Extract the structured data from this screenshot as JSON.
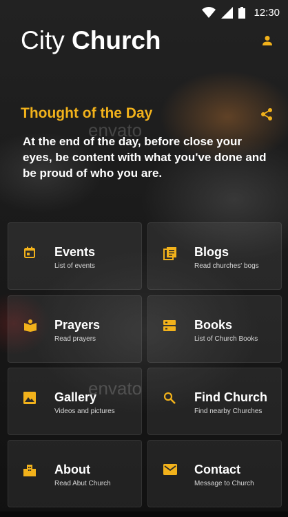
{
  "status_bar": {
    "time": "12:30"
  },
  "header": {
    "title_light": "City",
    "title_bold": "Church"
  },
  "thought": {
    "title": "Thought of the Day",
    "text": "At the end of the day, before close your eyes, be content with what you've done and be proud of who you are."
  },
  "watermark": "envato",
  "tiles": [
    {
      "label": "Events",
      "sub": "List of events",
      "icon": "calendar-icon"
    },
    {
      "label": "Blogs",
      "sub": "Read churches' bogs",
      "icon": "article-icon"
    },
    {
      "label": "Prayers",
      "sub": "Read prayers",
      "icon": "book-icon"
    },
    {
      "label": "Books",
      "sub": "List of Church Books",
      "icon": "storage-icon"
    },
    {
      "label": "Gallery",
      "sub": "Videos and pictures",
      "icon": "image-icon"
    },
    {
      "label": "Find Church",
      "sub": "Find nearby Churches",
      "icon": "search-icon"
    },
    {
      "label": "About",
      "sub": "Read Abut Church",
      "icon": "building-icon"
    },
    {
      "label": "Contact",
      "sub": "Message to Church",
      "icon": "mail-icon"
    }
  ],
  "colors": {
    "accent": "#f2b21b",
    "text": "#ffffff"
  }
}
